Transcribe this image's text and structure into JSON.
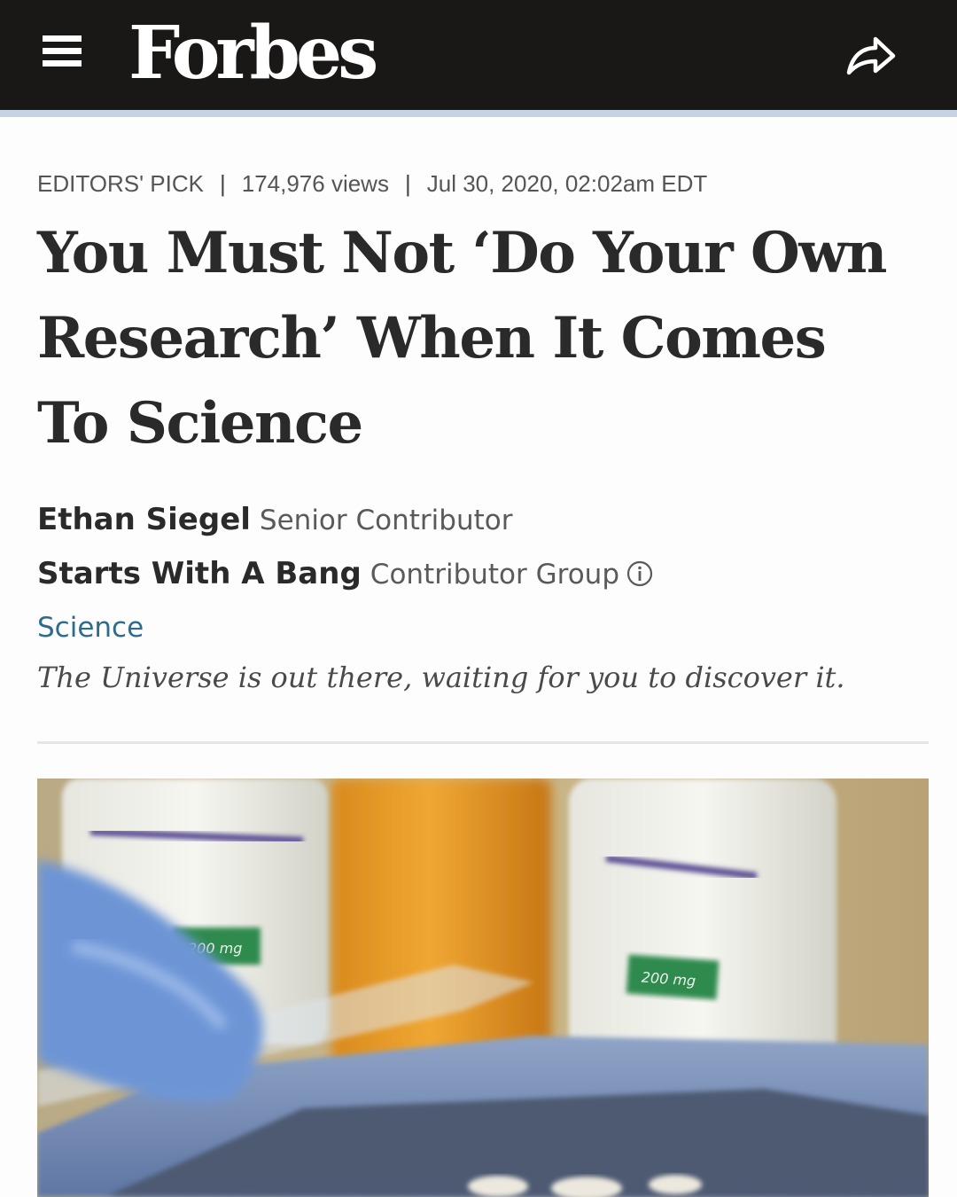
{
  "header": {
    "logo": "Forbes",
    "menu_icon": "hamburger-menu-icon",
    "share_icon": "share-arrow-icon",
    "background_color": "#1a1816"
  },
  "article": {
    "badge": "EDITORS' PICK",
    "views": "174,976 views",
    "date": "Jul 30, 2020, 02:02am EDT",
    "title": "You Must Not ‘Do Your Own Research’ When It Comes To Science",
    "author": {
      "name": "Ethan Siegel",
      "role": "Senior Contributor"
    },
    "group": {
      "name": "Starts With A Bang",
      "role": "Contributor Group",
      "info_icon": "info-circle-icon"
    },
    "channel": "Science",
    "tagline": "The Universe is out there, waiting for you to discover it.",
    "hero_image": {
      "bottle_left_label": "200 mg",
      "bottle_right_label": "200 mg"
    }
  },
  "colors": {
    "channel_link": "#2e6c8e",
    "accent_strip": "#c5d3e2"
  }
}
